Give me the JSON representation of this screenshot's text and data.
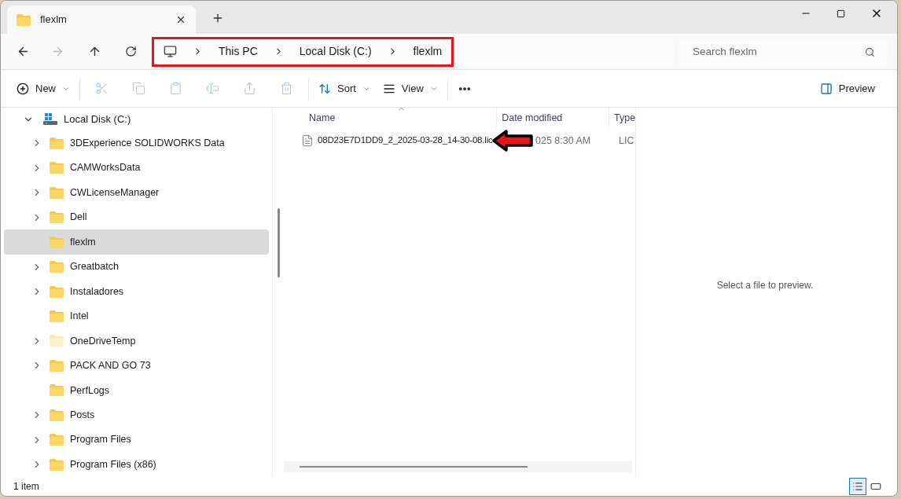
{
  "window": {
    "tab_title": "flexlm"
  },
  "address_bar": {
    "breadcrumbs": [
      "This PC",
      "Local Disk (C:)",
      "flexlm"
    ],
    "highlighted": true
  },
  "search": {
    "placeholder": "Search flexlm"
  },
  "toolbar": [
    {
      "kind": "new",
      "label": "New",
      "disabled": false
    },
    {
      "kind": "cut",
      "disabled": true
    },
    {
      "kind": "copy",
      "disabled": true
    },
    {
      "kind": "paste",
      "disabled": true
    },
    {
      "kind": "rename",
      "disabled": true
    },
    {
      "kind": "share",
      "disabled": true
    },
    {
      "kind": "delete",
      "disabled": true
    },
    {
      "kind": "sort",
      "label": "Sort",
      "disabled": false
    },
    {
      "kind": "view",
      "label": "View",
      "disabled": false
    },
    {
      "kind": "more",
      "disabled": false
    }
  ],
  "preview_button": {
    "label": "Preview"
  },
  "navigation": {
    "drive": {
      "label": "Local Disk (C:)",
      "expanded": true,
      "children": [
        {
          "label": "3DExperience SOLIDWORKS Data",
          "has_children": true,
          "selected": false,
          "faded": false
        },
        {
          "label": "CAMWorksData",
          "has_children": true,
          "selected": false,
          "faded": false
        },
        {
          "label": "CWLicenseManager",
          "has_children": true,
          "selected": false,
          "faded": false
        },
        {
          "label": "Dell",
          "has_children": true,
          "selected": false,
          "faded": false
        },
        {
          "label": "flexlm",
          "has_children": false,
          "selected": true,
          "faded": false
        },
        {
          "label": "Greatbatch",
          "has_children": true,
          "selected": false,
          "faded": false
        },
        {
          "label": "Instaladores",
          "has_children": true,
          "selected": false,
          "faded": false
        },
        {
          "label": "Intel",
          "has_children": false,
          "selected": false,
          "faded": false
        },
        {
          "label": "OneDriveTemp",
          "has_children": true,
          "selected": false,
          "faded": true
        },
        {
          "label": "PACK AND GO 73",
          "has_children": true,
          "selected": false,
          "faded": false
        },
        {
          "label": "PerfLogs",
          "has_children": false,
          "selected": false,
          "faded": false
        },
        {
          "label": "Posts",
          "has_children": true,
          "selected": false,
          "faded": false
        },
        {
          "label": "Program Files",
          "has_children": true,
          "selected": false,
          "faded": false
        },
        {
          "label": "Program Files (x86)",
          "has_children": true,
          "selected": false,
          "faded": false
        }
      ]
    }
  },
  "file_list": {
    "columns": [
      "Name",
      "Date modified",
      "Type"
    ],
    "rows": [
      {
        "name": "08D23E7D1DD9_2_2025-03-28_14-30-08.lic",
        "date_modified": "025 8:30 AM",
        "type": "LIC"
      }
    ],
    "pointer_arrow": true
  },
  "preview_pane": {
    "message": "Select a file to preview."
  },
  "status_bar": {
    "item_count": "1 item",
    "view_modes": [
      {
        "kind": "details",
        "selected": true
      },
      {
        "kind": "tiles",
        "selected": false
      }
    ]
  }
}
